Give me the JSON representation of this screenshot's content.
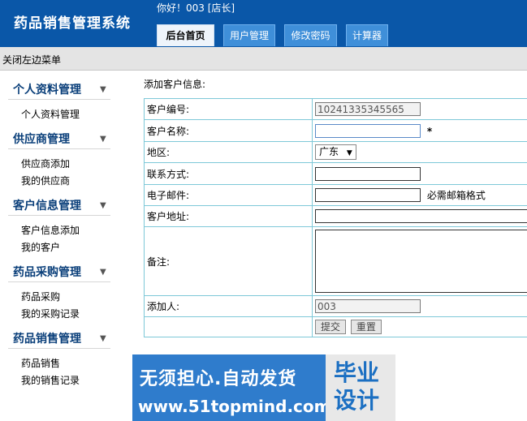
{
  "header": {
    "app_title": "药品销售管理系统",
    "greeting": "你好！003 [店长]",
    "tabs": [
      {
        "label": "后台首页",
        "active": true
      },
      {
        "label": "用户管理",
        "active": false
      },
      {
        "label": "修改密码",
        "active": false
      },
      {
        "label": "计算器",
        "active": false
      }
    ]
  },
  "menubar": {
    "close_menu": "关闭左边菜单"
  },
  "sidebar": {
    "groups": [
      {
        "title": "个人资料管理",
        "items": [
          "个人资料管理"
        ]
      },
      {
        "title": "供应商管理",
        "items": [
          "供应商添加",
          "我的供应商"
        ]
      },
      {
        "title": "客户信息管理",
        "items": [
          "客户信息添加",
          "我的客户"
        ]
      },
      {
        "title": "药品采购管理",
        "items": [
          "药品采购",
          "我的采购记录"
        ]
      },
      {
        "title": "药品销售管理",
        "items": [
          "药品销售",
          "我的销售记录"
        ]
      }
    ],
    "arrow_glyph": "▼"
  },
  "form": {
    "section_title": "添加客户信息:",
    "labels": {
      "customer_id": "客户编号:",
      "customer_name": "客户名称:",
      "region": "地区:",
      "contact": "联系方式:",
      "email": "电子邮件:",
      "address": "客户地址:",
      "remark": "备注:",
      "added_by": "添加人:"
    },
    "values": {
      "customer_id": "10241335345565",
      "customer_name": "",
      "region": "广东",
      "contact": "",
      "email": "",
      "address": "",
      "remark": "",
      "added_by": "003"
    },
    "required_mark": "*",
    "email_hint": "必需邮箱格式",
    "submit": "提交",
    "reset": "重置"
  },
  "watermark": {
    "slogan": "无须担心.自动发货",
    "url": "www.51topmind.com",
    "logo": "毕业设计"
  }
}
